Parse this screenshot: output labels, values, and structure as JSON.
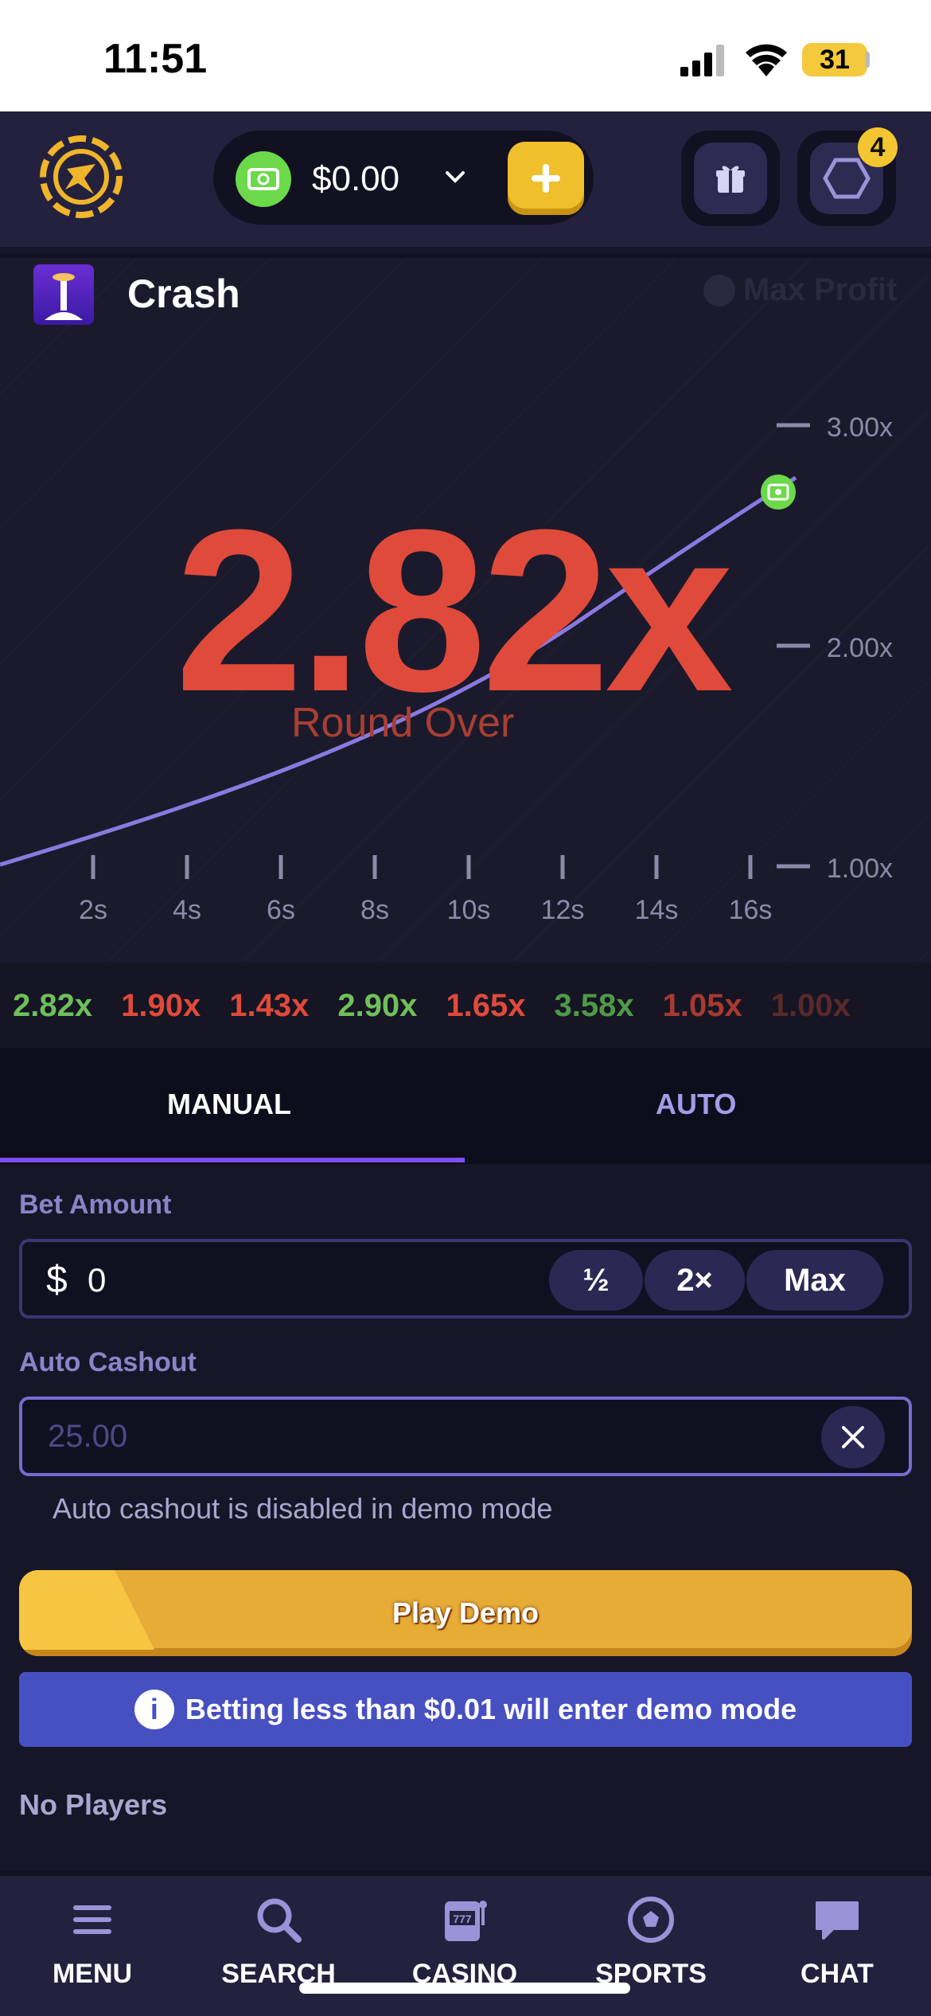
{
  "status_bar": {
    "time": "11:51",
    "battery": "31"
  },
  "header": {
    "balance": "$0.00",
    "notification_count": "4",
    "icons": [
      "logo-icon",
      "cash-icon",
      "chevron-down-icon",
      "plus-icon",
      "gift-icon",
      "hexagon-icon"
    ],
    "colors": {
      "cash": "#6bd94a",
      "add": "#f0bf2c",
      "badge": "#f3c530"
    }
  },
  "game": {
    "title": "Crash",
    "max_profit_label": "Max Profit",
    "multiplier": "2.82x",
    "status": "Round Over",
    "y_ticks": [
      "3.00x",
      "2.00x",
      "1.00x"
    ],
    "x_ticks": [
      "2s",
      "4s",
      "6s",
      "8s",
      "10s",
      "12s",
      "14s",
      "16s"
    ],
    "colors": {
      "multiplier": "#e04a3a",
      "curve": "#8a7ae0"
    }
  },
  "history": [
    {
      "value": "2.82x",
      "color": "#6fc05a"
    },
    {
      "value": "1.90x",
      "color": "#e04a3a"
    },
    {
      "value": "1.43x",
      "color": "#e04a3a"
    },
    {
      "value": "2.90x",
      "color": "#6fc05a"
    },
    {
      "value": "1.65x",
      "color": "#e04a3a"
    },
    {
      "value": "3.58x",
      "color": "#4f9a47"
    },
    {
      "value": "1.05x",
      "color": "#a83a30"
    },
    {
      "value": "1.00x",
      "color": "#5a2a2a"
    }
  ],
  "tabs": {
    "manual": "MANUAL",
    "auto": "AUTO",
    "active": "manual"
  },
  "form": {
    "bet_amount_label": "Bet Amount",
    "currency_symbol": "$",
    "bet_value": "0",
    "half_label": "½",
    "double_label": "2×",
    "max_label": "Max",
    "auto_cashout_label": "Auto Cashout",
    "auto_cashout_value": "25.00",
    "auto_cashout_note": "Auto cashout is disabled in demo mode",
    "play_button": "Play Demo",
    "info_text": "Betting less than $0.01 will enter demo mode",
    "no_players": "No Players"
  },
  "bottom_nav": [
    {
      "label": "MENU",
      "icon": "menu-icon"
    },
    {
      "label": "SEARCH",
      "icon": "search-icon"
    },
    {
      "label": "CASINO",
      "icon": "slot-machine-icon"
    },
    {
      "label": "SPORTS",
      "icon": "soccer-ball-icon"
    },
    {
      "label": "CHAT",
      "icon": "chat-icon"
    }
  ]
}
